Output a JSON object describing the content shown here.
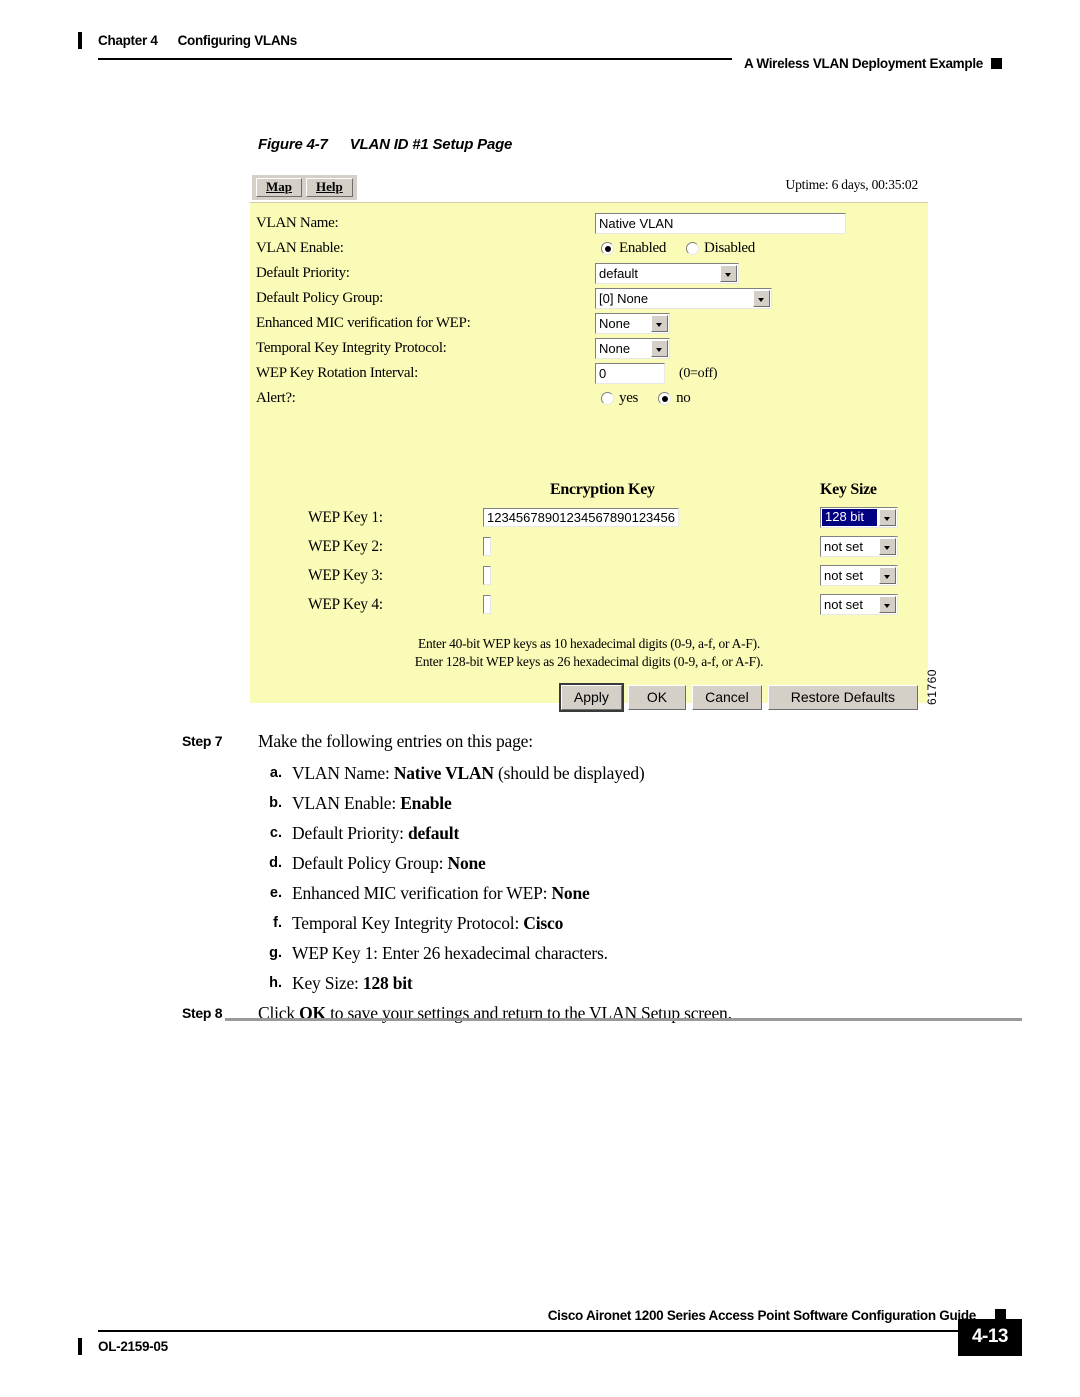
{
  "header": {
    "chapter_number": "Chapter 4",
    "chapter_title": "Configuring VLANs",
    "section_title": "A Wireless VLAN Deployment Example"
  },
  "figure": {
    "caption_number": "Figure 4-7",
    "caption_title": "VLAN ID #1 Setup Page",
    "figure_id": "61760",
    "toolbar": {
      "map_label": "Map",
      "help_label": "Help",
      "uptime": "Uptime: 6 days, 00:35:02"
    },
    "fields": {
      "vlan_name_label": "VLAN Name:",
      "vlan_name_value": "Native VLAN",
      "vlan_enable_label": "VLAN Enable:",
      "vlan_enable_option_1": "Enabled",
      "vlan_enable_option_2": "Disabled",
      "default_priority_label": "Default Priority:",
      "default_priority_value": "default",
      "default_policy_group_label": "Default Policy Group:",
      "default_policy_group_value": "[0]  None",
      "enhanced_mic_label": "Enhanced MIC verification for WEP:",
      "enhanced_mic_value": "None",
      "tkip_label": "Temporal Key Integrity Protocol:",
      "tkip_value": "None",
      "wep_rotation_label": "WEP Key Rotation Interval:",
      "wep_rotation_value": "0",
      "wep_rotation_hint": "(0=off)",
      "alert_label": "Alert?:",
      "alert_option_1": "yes",
      "alert_option_2": "no"
    },
    "wep": {
      "encryption_key_header": "Encryption Key",
      "key_size_header": "Key Size",
      "keys": [
        {
          "label": "WEP Key 1:",
          "value": "12345678901234567890123456",
          "size": "128 bit",
          "selected": true
        },
        {
          "label": "WEP Key 2:",
          "value": "",
          "size": "not set",
          "selected": false
        },
        {
          "label": "WEP Key 3:",
          "value": "",
          "size": "not set",
          "selected": false
        },
        {
          "label": "WEP Key 4:",
          "value": "",
          "size": "not set",
          "selected": false
        }
      ]
    },
    "notes": {
      "line1": "Enter 40-bit WEP keys as 10 hexadecimal digits (0-9, a-f, or A-F).",
      "line2": "Enter 128-bit WEP keys as 26 hexadecimal digits (0-9, a-f, or A-F)."
    },
    "buttons": {
      "apply": "Apply",
      "ok": "OK",
      "cancel": "Cancel",
      "restore_defaults": "Restore Defaults"
    }
  },
  "steps": [
    {
      "label": "Step 7",
      "text": "Make the following entries on this page:",
      "substeps": [
        {
          "marker": "a.",
          "prefix": "VLAN Name: ",
          "bold": "Native VLAN",
          "suffix": " (should be displayed)"
        },
        {
          "marker": "b.",
          "prefix": "VLAN Enable: ",
          "bold": "Enable",
          "suffix": ""
        },
        {
          "marker": "c.",
          "prefix": "Default Priority: ",
          "bold": "default",
          "suffix": ""
        },
        {
          "marker": "d.",
          "prefix": "Default Policy Group: ",
          "bold": "None",
          "suffix": ""
        },
        {
          "marker": "e.",
          "prefix": "Enhanced MIC verification for WEP: ",
          "bold": "None",
          "suffix": ""
        },
        {
          "marker": "f.",
          "prefix": "Temporal Key Integrity Protocol: ",
          "bold": "Cisco",
          "suffix": ""
        },
        {
          "marker": "g.",
          "prefix": "WEP Key 1: Enter 26 hexadecimal characters.",
          "bold": "",
          "suffix": ""
        },
        {
          "marker": "h.",
          "prefix": "Key Size: ",
          "bold": "128 bit",
          "suffix": ""
        }
      ]
    },
    {
      "label": "Step 8",
      "prefix": "Click ",
      "bold": "OK",
      "suffix": " to save your settings and return to the VLAN Setup screen."
    }
  ],
  "footer": {
    "guide_title": "Cisco Aironet 1200 Series Access Point Software Configuration Guide",
    "doc_number": "OL-2159-05",
    "page_number": "4-13"
  }
}
